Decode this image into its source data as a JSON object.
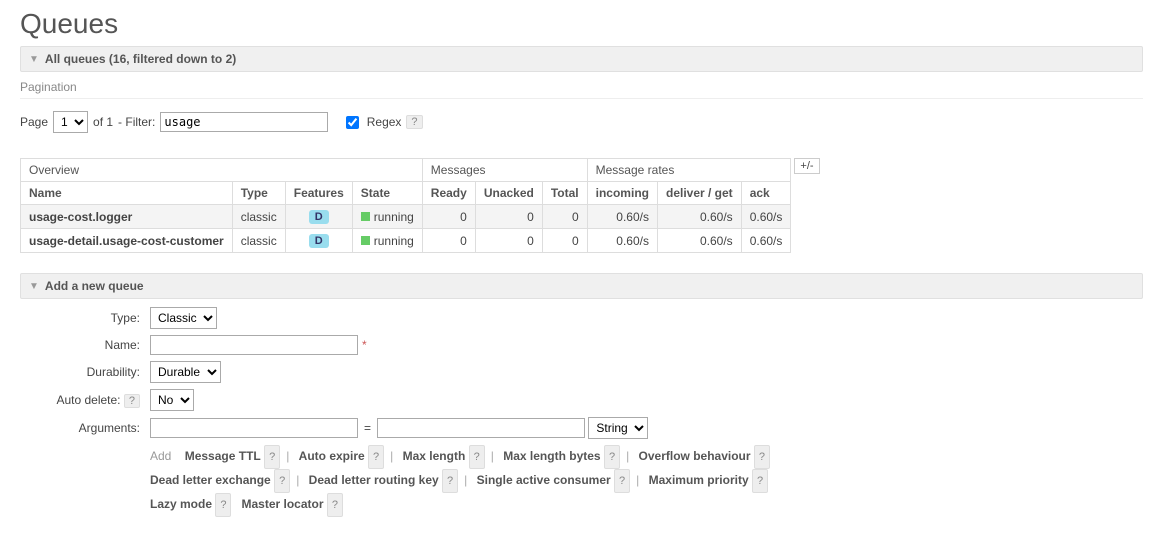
{
  "page": {
    "title": "Queues"
  },
  "sections": {
    "all_queues_header": "All queues (16, filtered down to 2)",
    "add_queue_header": "Add a new queue"
  },
  "pagination": {
    "label": "Pagination",
    "page_label": "Page",
    "page_value": "1",
    "of_label": "of 1",
    "filter_label": "- Filter:",
    "filter_value": "usage",
    "regex_label": "Regex",
    "regex_checked": true
  },
  "table": {
    "groups": {
      "overview": "Overview",
      "messages": "Messages",
      "rates": "Message rates"
    },
    "cols": {
      "name": "Name",
      "type": "Type",
      "features": "Features",
      "state": "State",
      "ready": "Ready",
      "unacked": "Unacked",
      "total": "Total",
      "incoming": "incoming",
      "deliver": "deliver / get",
      "ack": "ack"
    },
    "plusminus": "+/-",
    "rows": [
      {
        "name": "usage-cost.logger",
        "type": "classic",
        "feature": "D",
        "state": "running",
        "ready": "0",
        "unacked": "0",
        "total": "0",
        "incoming": "0.60/s",
        "deliver": "0.60/s",
        "ack": "0.60/s"
      },
      {
        "name": "usage-detail.usage-cost-customer",
        "type": "classic",
        "feature": "D",
        "state": "running",
        "ready": "0",
        "unacked": "0",
        "total": "0",
        "incoming": "0.60/s",
        "deliver": "0.60/s",
        "ack": "0.60/s"
      }
    ]
  },
  "form": {
    "type_label": "Type:",
    "type_value": "Classic",
    "name_label": "Name:",
    "name_value": "",
    "durability_label": "Durability:",
    "durability_value": "Durable",
    "autodelete_label": "Auto delete:",
    "autodelete_value": "No",
    "arguments_label": "Arguments:",
    "arg_key": "",
    "arg_eq": "=",
    "arg_val": "",
    "arg_type": "String",
    "add_label": "Add",
    "links": [
      "Message TTL",
      "Auto expire",
      "Max length",
      "Max length bytes",
      "Overflow behaviour",
      "Dead letter exchange",
      "Dead letter routing key",
      "Single active consumer",
      "Maximum priority",
      "Lazy mode",
      "Master locator"
    ]
  }
}
